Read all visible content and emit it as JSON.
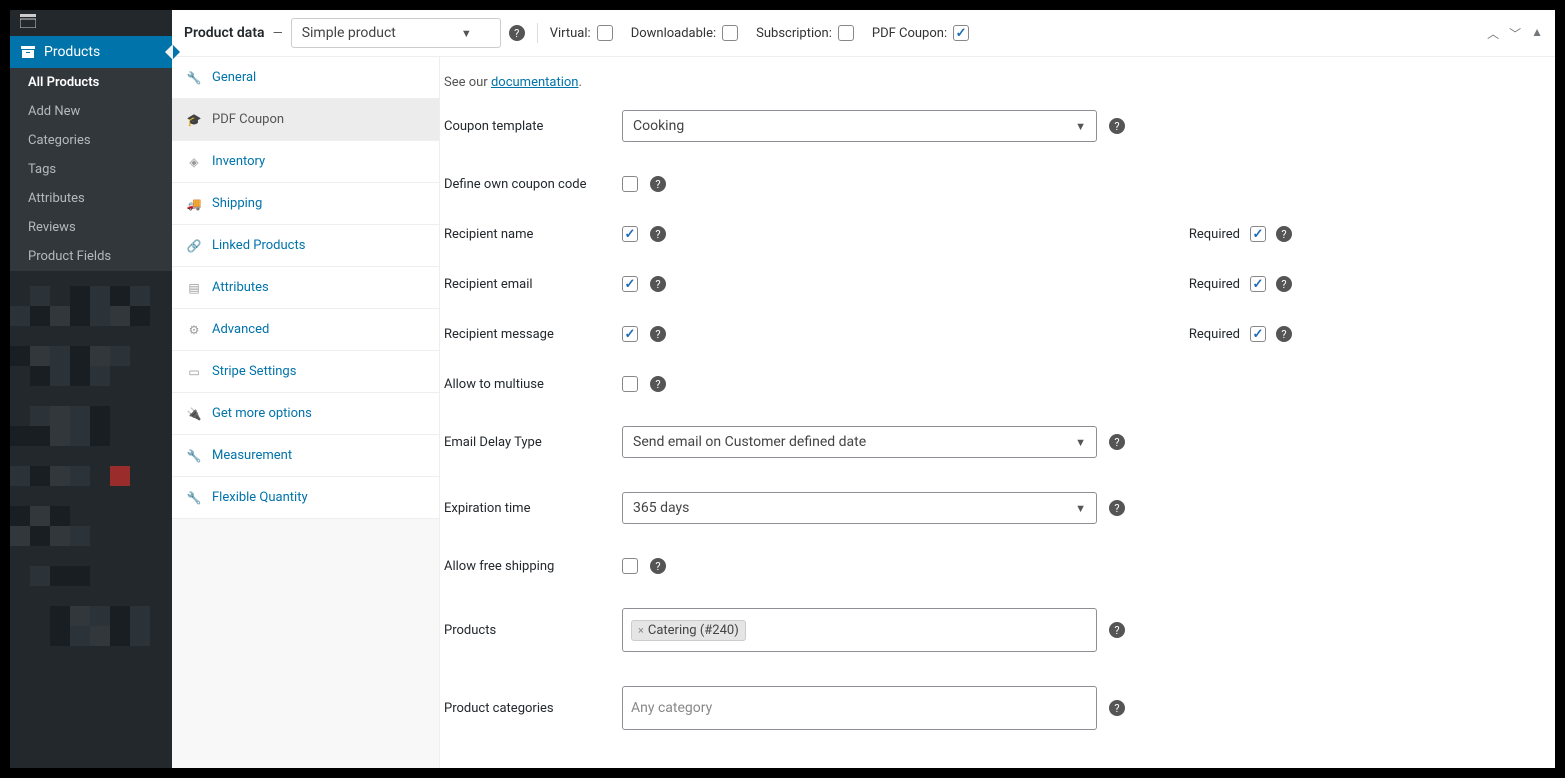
{
  "sidebar": {
    "products_label": "Products",
    "submenu": [
      "All Products",
      "Add New",
      "Categories",
      "Tags",
      "Attributes",
      "Reviews",
      "Product Fields"
    ]
  },
  "header": {
    "title": "Product data",
    "dash": "—",
    "product_type": "Simple product",
    "checks": {
      "virtual": "Virtual:",
      "downloadable": "Downloadable:",
      "subscription": "Subscription:",
      "pdf_coupon": "PDF Coupon:"
    }
  },
  "tabs": [
    "General",
    "PDF Coupon",
    "Inventory",
    "Shipping",
    "Linked Products",
    "Attributes",
    "Advanced",
    "Stripe Settings",
    "Get more options",
    "Measurement",
    "Flexible Quantity"
  ],
  "form": {
    "intro_text": "See our ",
    "intro_link": "documentation",
    "intro_period": ".",
    "coupon_template_label": "Coupon template",
    "coupon_template_value": "Cooking",
    "define_own_label": "Define own coupon code",
    "recipient_name_label": "Recipient name",
    "recipient_email_label": "Recipient email",
    "recipient_message_label": "Recipient message",
    "required_label": "Required",
    "allow_multiuse_label": "Allow to multiuse",
    "email_delay_label": "Email Delay Type",
    "email_delay_value": "Send email on Customer defined date",
    "expiration_label": "Expiration time",
    "expiration_value": "365 days",
    "free_shipping_label": "Allow free shipping",
    "products_label": "Products",
    "products_tag": "Catering (#240)",
    "categories_label": "Product categories",
    "categories_placeholder": "Any category"
  }
}
